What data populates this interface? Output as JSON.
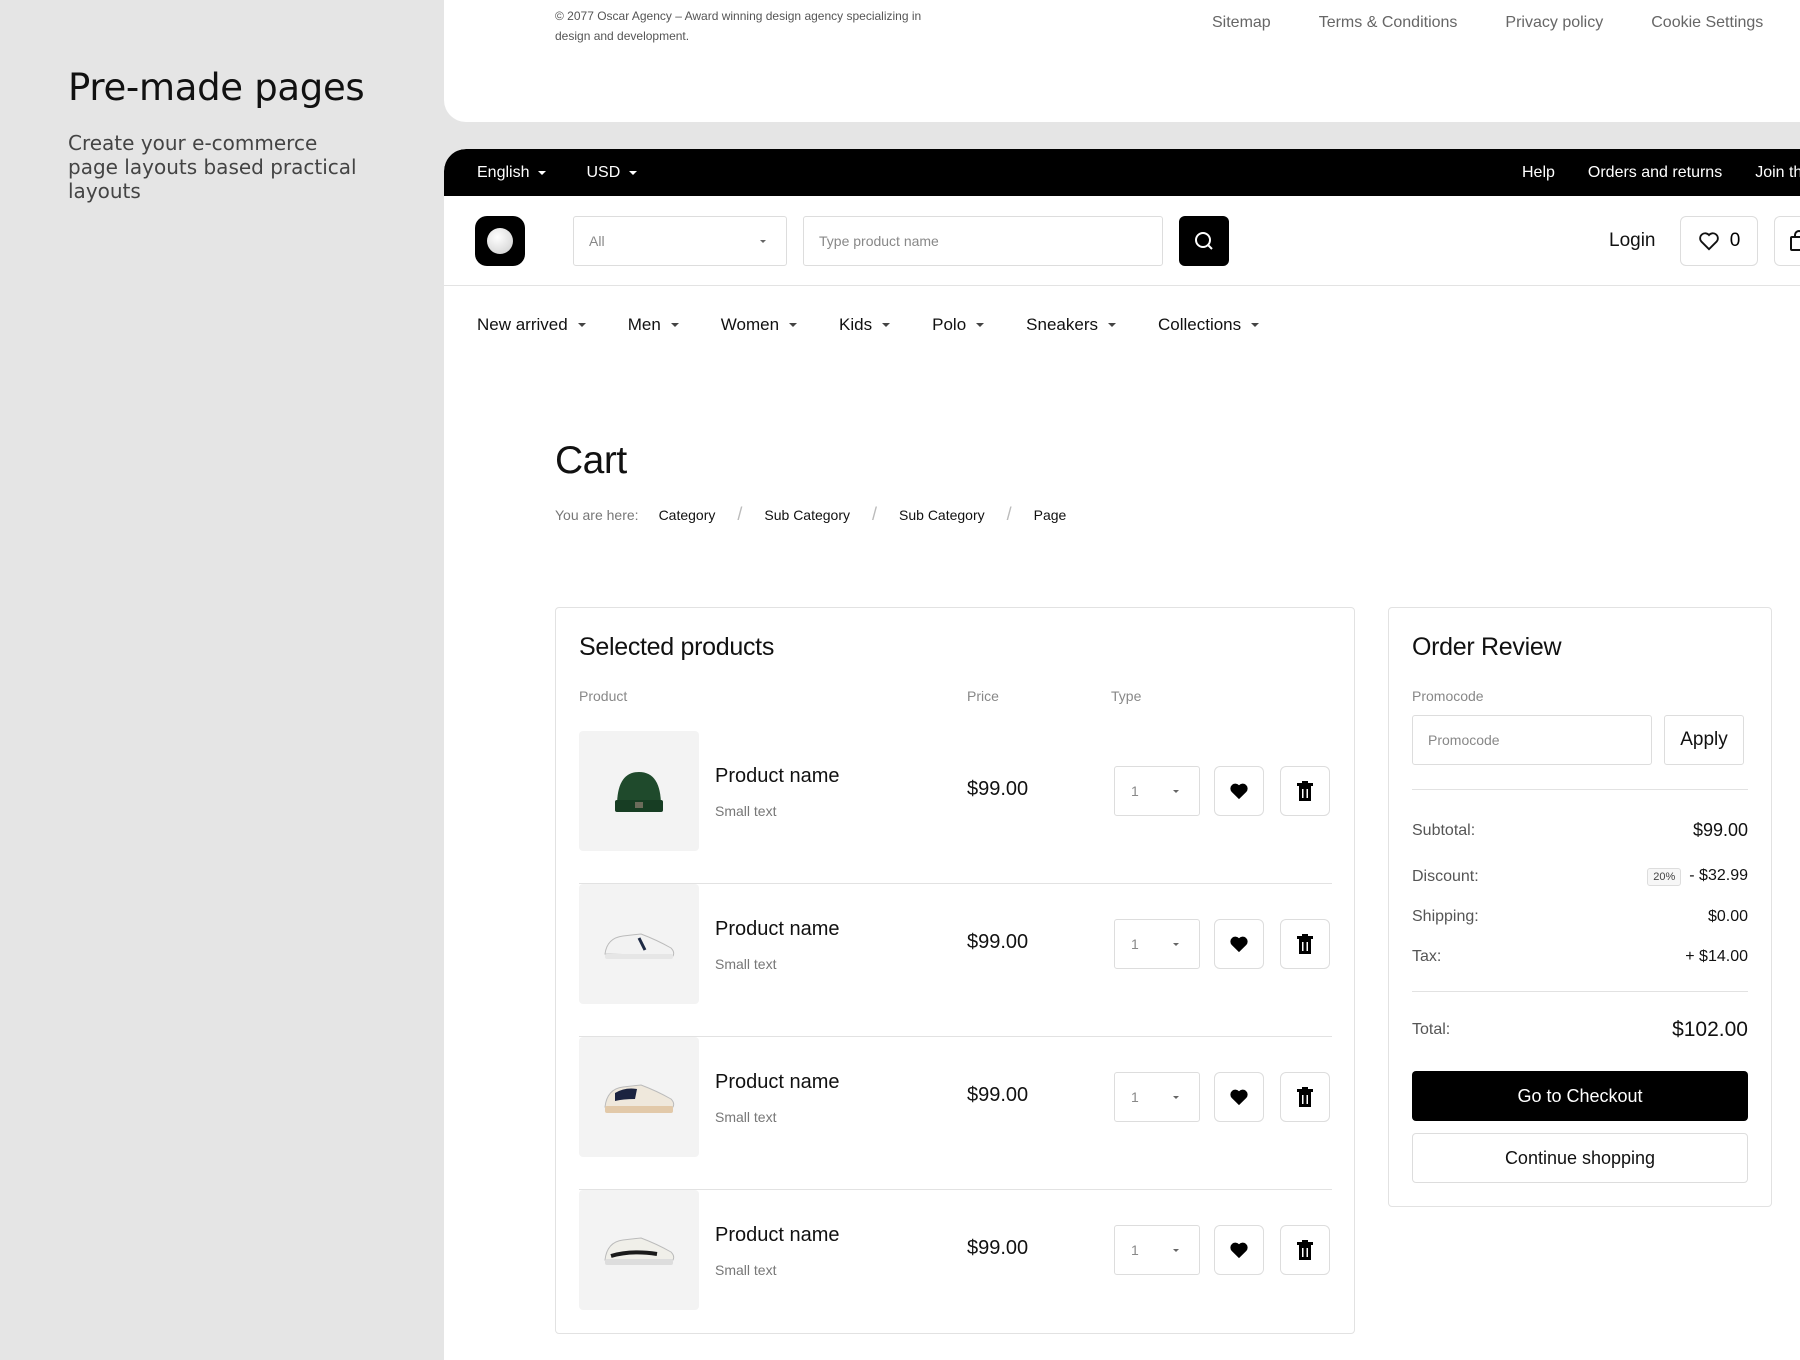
{
  "intro": {
    "title": "Pre-made pages",
    "description": "Create your e-commerce page layouts based practical layouts"
  },
  "footer": {
    "copyright": "© 2077 Oscar Agency – Award winning design agency specializing in design and development.",
    "links": [
      "Sitemap",
      "Terms & Conditions",
      "Privacy policy",
      "Cookie Settings"
    ]
  },
  "topbar": {
    "language": "English",
    "currency": "USD",
    "links": [
      "Help",
      "Orders and returns",
      "Join th"
    ]
  },
  "header": {
    "category_value": "All",
    "search_placeholder": "Type product name",
    "login_label": "Login",
    "wishlist_count": "0"
  },
  "nav": {
    "items": [
      "New arrived",
      "Men",
      "Women",
      "Kids",
      "Polo",
      "Sneakers",
      "Collections"
    ]
  },
  "page": {
    "title": "Cart",
    "breadcrumb_lead": "You are here:",
    "breadcrumbs": [
      "Category",
      "Sub Category",
      "Sub Category",
      "Page"
    ]
  },
  "products": {
    "heading": "Selected products",
    "columns": {
      "product": "Product",
      "price": "Price",
      "type": "Type"
    },
    "items": [
      {
        "name": "Product name",
        "sub": "Small text",
        "price": "$99.00",
        "qty": "1",
        "image": "green-beanie"
      },
      {
        "name": "Product name",
        "sub": "Small text",
        "price": "$99.00",
        "qty": "1",
        "image": "white-sneaker"
      },
      {
        "name": "Product name",
        "sub": "Small text",
        "price": "$99.00",
        "qty": "1",
        "image": "navy-sneaker"
      },
      {
        "name": "Product name",
        "sub": "Small text",
        "price": "$99.00",
        "qty": "1",
        "image": "white-black-sneaker"
      }
    ]
  },
  "review": {
    "heading": "Order Review",
    "promo_label": "Promocode",
    "promo_placeholder": "Promocode",
    "apply_label": "Apply",
    "subtotal_label": "Subtotal:",
    "subtotal_value": "$99.00",
    "discount_label": "Discount:",
    "discount_badge": "20%",
    "discount_value": "- $32.99",
    "shipping_label": "Shipping:",
    "shipping_value": "$0.00",
    "tax_label": "Tax:",
    "tax_value": "+ $14.00",
    "total_label": "Total:",
    "total_value": "$102.00",
    "checkout_label": "Go to Checkout",
    "continue_label": "Continue shopping"
  },
  "colors": {
    "accent": "#000000",
    "background": "#e5e5e5",
    "card": "#ffffff"
  }
}
